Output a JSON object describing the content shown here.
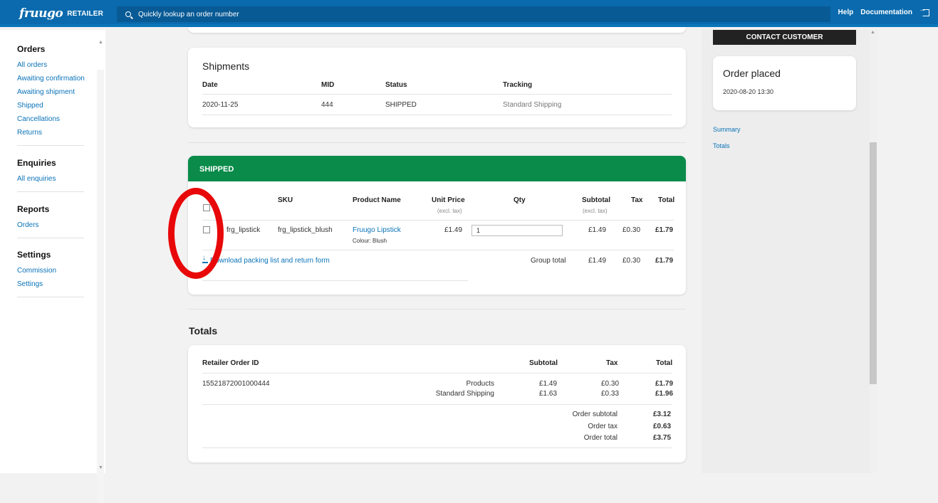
{
  "header": {
    "logo_mark": "fruugo",
    "logo_text": "RETAILER",
    "search_placeholder": "Quickly lookup an order number",
    "help": "Help",
    "documentation": "Documentation"
  },
  "sidebar": {
    "orders": {
      "title": "Orders",
      "items": [
        "All orders",
        "Awaiting confirmation",
        "Awaiting shipment",
        "Shipped",
        "Cancellations",
        "Returns"
      ]
    },
    "enquiries": {
      "title": "Enquiries",
      "items": [
        "All enquiries"
      ]
    },
    "reports": {
      "title": "Reports",
      "items": [
        "Orders"
      ]
    },
    "settings": {
      "title": "Settings",
      "items": [
        "Commission",
        "Settings"
      ]
    }
  },
  "shipments": {
    "title": "Shipments",
    "headers": [
      "Date",
      "MID",
      "Status",
      "Tracking"
    ],
    "row": [
      "2020-11-25",
      "444",
      "SHIPPED",
      "Standard Shipping"
    ]
  },
  "shipped": {
    "banner": "SHIPPED",
    "headers": {
      "sku": "SKU",
      "product_name": "Product Name",
      "unit_price": "Unit Price",
      "unit_price_sub": "(excl. tax)",
      "qty": "Qty",
      "subtotal": "Subtotal",
      "subtotal_sub": "(excl. tax)",
      "tax": "Tax",
      "total": "Total"
    },
    "row": {
      "name_partial": "frg_lipstick",
      "sku": "frg_lipstick_blush",
      "product": "Fruugo Lipstick",
      "colour": "Colour: Blush",
      "unit_price": "£1.49",
      "qty": "1",
      "subtotal": "£1.49",
      "tax": "£0.30",
      "total": "£1.79"
    },
    "download_link": "Download packing list and return form",
    "group_total": {
      "label": "Group total",
      "subtotal": "£1.49",
      "tax": "£0.30",
      "total": "£1.79"
    }
  },
  "totals": {
    "heading": "Totals",
    "headers": {
      "order_id": "Retailer Order ID",
      "subtotal": "Subtotal",
      "tax": "Tax",
      "total": "Total"
    },
    "order_id": "15521872001000444",
    "lines": [
      {
        "label": "Products",
        "subtotal": "£1.49",
        "tax": "£0.30",
        "total": "£1.79"
      },
      {
        "label": "Standard Shipping",
        "subtotal": "£1.63",
        "tax": "£0.33",
        "total": "£1.96"
      }
    ],
    "summary": [
      {
        "label": "Order subtotal",
        "value": "£3.12"
      },
      {
        "label": "Order tax",
        "value": "£0.63"
      },
      {
        "label": "Order total",
        "value": "£3.75"
      }
    ]
  },
  "right_panel": {
    "contact_button": "CONTACT CUSTOMER",
    "order_placed_title": "Order placed",
    "order_placed_date": "2020-08-20 13:30",
    "nav": [
      "Summary",
      "Totals"
    ]
  },
  "colors": {
    "brand_blue": "#0a6aad",
    "shipped_green": "#0a8b4a",
    "link_blue": "#0a73b8",
    "annotation_red": "#e8080a"
  }
}
